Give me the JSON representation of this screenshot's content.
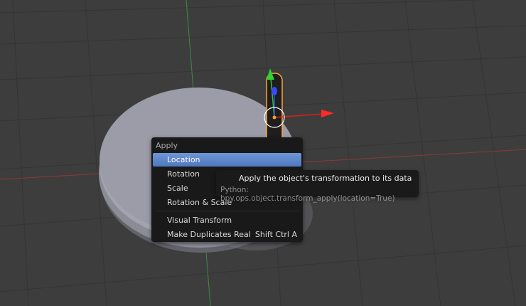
{
  "colors": {
    "background": "#3d3d3d",
    "grid": "#353535",
    "x_axis": "#8a3a3a",
    "y_axis": "#3f8a3f",
    "disc": "#9d9dab",
    "selection_outline": "#ffa33a",
    "menu_bg": "#191919",
    "menu_highlight": "#5c85cc"
  },
  "apply_menu": {
    "title": "Apply",
    "items": [
      {
        "label": "Location",
        "shortcut": "",
        "active": true
      },
      {
        "label": "Rotation",
        "shortcut": "",
        "active": false
      },
      {
        "label": "Scale",
        "shortcut": "",
        "active": false
      },
      {
        "label": "Rotation & Scale",
        "shortcut": "",
        "active": false
      },
      {
        "label": "Visual Transform",
        "shortcut": "",
        "active": false
      },
      {
        "label": "Make Duplicates Real",
        "shortcut": "Shift Ctrl A",
        "active": false
      }
    ]
  },
  "tooltip": {
    "description": "Apply the object's transformation to its data",
    "python": "Python: bpy.ops.object.transform_apply(location=True)"
  }
}
